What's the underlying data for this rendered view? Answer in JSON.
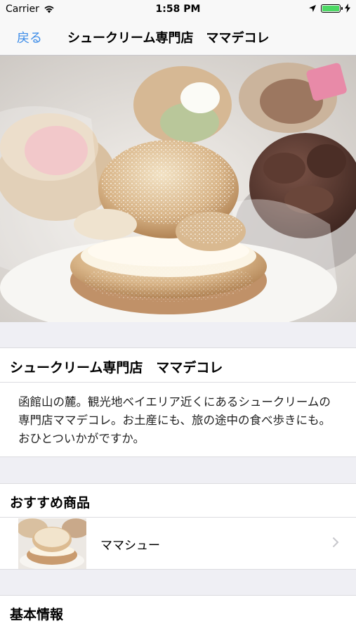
{
  "status_bar": {
    "carrier": "Carrier",
    "time": "1:58 PM",
    "battery_level": 1.0
  },
  "nav": {
    "back_label": "戻る",
    "title": "シュークリーム専門店　ママデコレ"
  },
  "shop": {
    "name": "シュークリーム専門店　ママデコレ",
    "description": "函館山の麓。観光地ベイエリア近くにあるシュークリームの専門店ママデコレ。お土産にも、旅の途中の食べ歩きにも。おひとついかがですか。"
  },
  "recommended": {
    "header": "おすすめ商品",
    "items": [
      {
        "name": "ママシュー",
        "icon": "chevron-right-icon"
      }
    ]
  },
  "info": {
    "header": "基本情報"
  },
  "colors": {
    "accent": "#3b8be8",
    "background": "#efeff4",
    "battery": "#4cd964"
  }
}
